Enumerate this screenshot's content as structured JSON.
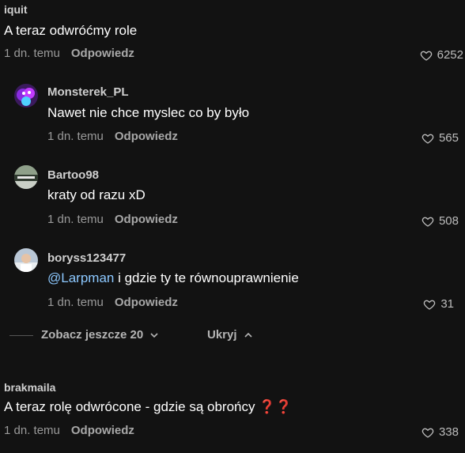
{
  "comments": [
    {
      "username": "iquit",
      "text": "A teraz odwróćmy role",
      "time": "1 dn. temu",
      "reply_label": "Odpowiedz",
      "likes": "6252"
    },
    {
      "username": "brakmaila",
      "text": "A teraz rolę odwrócone - gdzie są obrońcy",
      "emoji": "❓❓",
      "time": "1 dn. temu",
      "reply_label": "Odpowiedz",
      "likes": "338"
    }
  ],
  "replies": [
    {
      "username": "Monsterek_PL",
      "text": "Nawet nie chce myslec co by było",
      "time": "1 dn. temu",
      "reply_label": "Odpowiedz",
      "likes": "565"
    },
    {
      "username": "Bartoo98",
      "text": "kraty od razu xD",
      "time": "1 dn. temu",
      "reply_label": "Odpowiedz",
      "likes": "508"
    },
    {
      "username": "boryss123477",
      "mention": "@Larpman",
      "text": " i gdzie ty te równouprawnienie",
      "time": "1 dn. temu",
      "reply_label": "Odpowiedz",
      "likes": "31"
    }
  ],
  "more_replies": {
    "view_more_label": "Zobacz jeszcze 20",
    "hide_label": "Ukryj"
  },
  "colors": {
    "background": "#121212",
    "mention": "#8cc8ff",
    "question_mark_emoji": "#e0302b"
  }
}
